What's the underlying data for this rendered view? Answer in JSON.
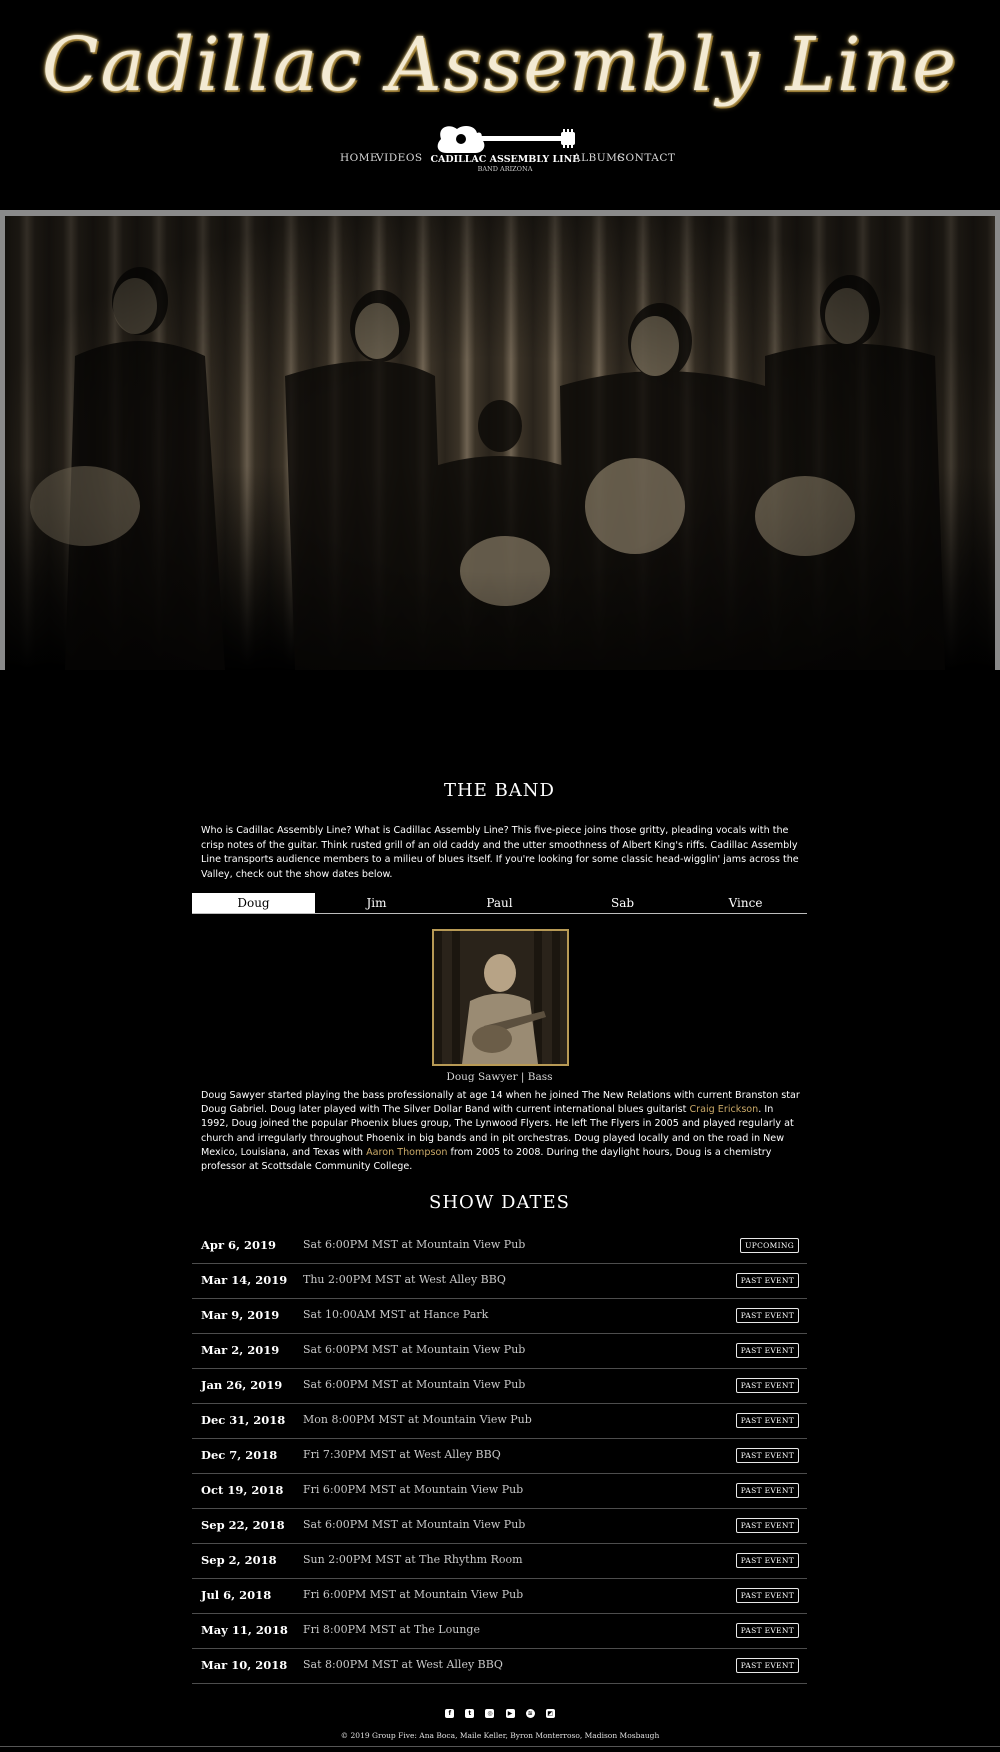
{
  "header": {
    "logo_text": "Cadillac Assembly Line",
    "nav": {
      "home": "HOME",
      "videos": "VIDEOS",
      "albums": "ALBUMS",
      "contact": "CONTACT"
    },
    "brand_name": "CADILLAC ASSEMBLY LINE",
    "brand_sub": "BAND ARIZONA"
  },
  "band": {
    "title": "THE BAND",
    "intro": "Who is Cadillac Assembly Line? What is Cadillac Assembly Line? This five-piece joins those gritty, pleading vocals with the crisp notes of the guitar. Think rusted grill of an old caddy and the utter smoothness of Albert King's riffs. Cadillac Assembly Line transports audience members to a milieu of blues itself. If you're looking for some classic head-wigglin' jams across the Valley, check out the show dates below.",
    "tabs": [
      "Doug",
      "Jim",
      "Paul",
      "Sab",
      "Vince"
    ],
    "active_tab": "Doug",
    "member_caption": "Doug Sawyer | Bass",
    "bio": {
      "part1": "Doug Sawyer started playing the bass professionally at age 14 when he joined The New Relations with current Branston star Doug Gabriel. Doug later played with The Silver Dollar Band with current international blues guitarist ",
      "link1": "Craig Erickson",
      "part2": ". In 1992, Doug joined the popular Phoenix blues group, The Lynwood Flyers. He left The Flyers in 2005 and played regularly at church and irregularly throughout Phoenix in big bands and in pit orchestras. Doug played locally and on the road in New Mexico, Louisiana, and Texas with ",
      "link2": "Aaron Thompson",
      "part3": " from 2005 to 2008. During the daylight hours, Doug is a chemistry professor at Scottsdale Community College."
    }
  },
  "shows": {
    "title": "SHOW DATES",
    "items": [
      {
        "date": "Apr 6, 2019",
        "info": "Sat 6:00PM MST at Mountain View Pub",
        "status": "UPCOMING"
      },
      {
        "date": "Mar 14, 2019",
        "info": "Thu 2:00PM MST at West Alley BBQ",
        "status": "PAST EVENT"
      },
      {
        "date": "Mar 9, 2019",
        "info": "Sat 10:00AM MST at Hance Park",
        "status": "PAST EVENT"
      },
      {
        "date": "Mar 2, 2019",
        "info": "Sat 6:00PM MST at Mountain View Pub",
        "status": "PAST EVENT"
      },
      {
        "date": "Jan 26, 2019",
        "info": "Sat 6:00PM MST at Mountain View Pub",
        "status": "PAST EVENT"
      },
      {
        "date": "Dec 31, 2018",
        "info": "Mon 8:00PM MST at Mountain View Pub",
        "status": "PAST EVENT"
      },
      {
        "date": "Dec 7, 2018",
        "info": "Fri 7:30PM MST at West Alley BBQ",
        "status": "PAST EVENT"
      },
      {
        "date": "Oct 19, 2018",
        "info": "Fri 6:00PM MST at Mountain View Pub",
        "status": "PAST EVENT"
      },
      {
        "date": "Sep 22, 2018",
        "info": "Sat 6:00PM MST at Mountain View Pub",
        "status": "PAST EVENT"
      },
      {
        "date": "Sep 2, 2018",
        "info": "Sun 2:00PM MST at The Rhythm Room",
        "status": "PAST EVENT"
      },
      {
        "date": "Jul 6, 2018",
        "info": "Fri 6:00PM MST at Mountain View Pub",
        "status": "PAST EVENT"
      },
      {
        "date": "May 11, 2018",
        "info": "Fri 8:00PM MST at The Lounge",
        "status": "PAST EVENT"
      },
      {
        "date": "Mar 10, 2018",
        "info": "Sat 8:00PM MST at West Alley BBQ",
        "status": "PAST EVENT"
      }
    ]
  },
  "social": [
    "facebook-icon",
    "twitter-icon",
    "instagram-icon",
    "youtube-icon",
    "spotify-icon",
    "bandcamp-icon"
  ],
  "footer": {
    "copyright": "© 2019 Group Five: Ana Boca, Maile Keller, Byron Monterroso, Madison Mosbaugh"
  },
  "colors": {
    "accent_gold": "#b89a55",
    "link": "#caa968",
    "background": "#000000"
  }
}
